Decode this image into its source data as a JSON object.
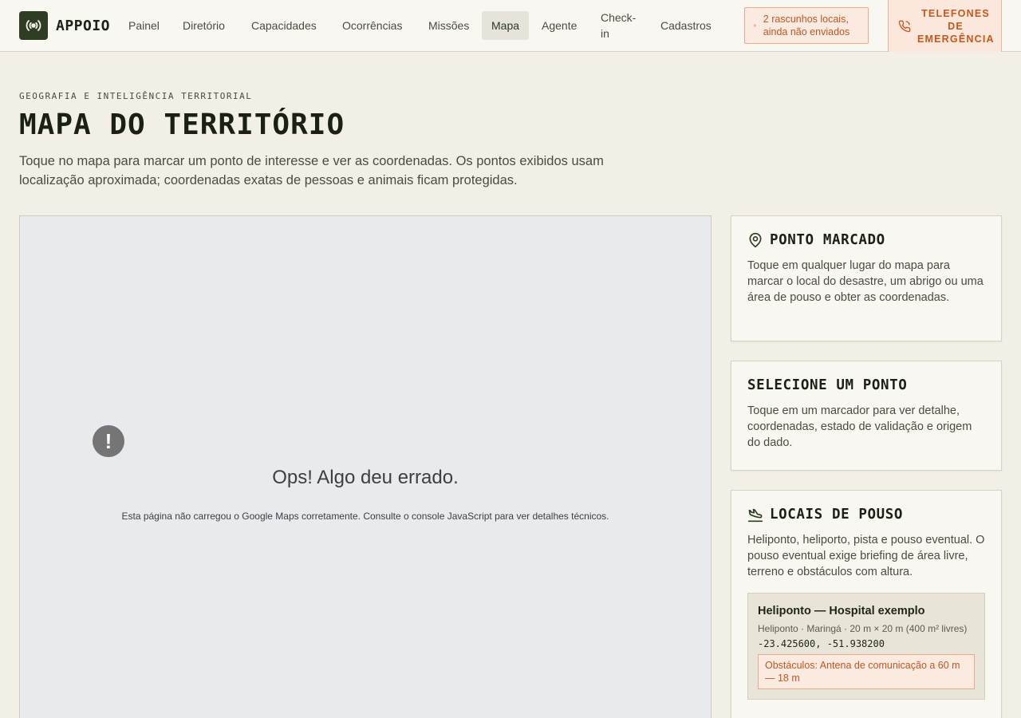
{
  "app": {
    "name": "APPOIO",
    "logo_icon": "radio-broadcast-icon"
  },
  "nav": {
    "items": [
      {
        "label": "Painel",
        "active": false
      },
      {
        "label": "Diretório",
        "active": false
      },
      {
        "label": "Capacidades",
        "active": false
      },
      {
        "label": "Ocorrências",
        "active": false
      },
      {
        "label": "Missões",
        "active": false
      },
      {
        "label": "Mapa",
        "active": true
      },
      {
        "label": "Agente",
        "active": false
      },
      {
        "label": "Check-in",
        "active": false
      },
      {
        "label": "Cadastros",
        "active": false
      }
    ],
    "drafts_badge": "2 rascunhos locais, ainda não enviados",
    "emergency_button": "TELEFONES DE EMERGÊNCIA"
  },
  "header": {
    "eyebrow": "GEOGRAFIA E INTELIGÊNCIA TERRITORIAL",
    "title": "MAPA DO TERRITÓRIO",
    "description": "Toque no mapa para marcar um ponto de interesse e ver as coordenadas. Os pontos exibidos usam localização aproximada; coordenadas exatas de pessoas e animais ficam protegidas."
  },
  "map": {
    "error_icon": "!",
    "error_title": "Ops! Algo deu errado.",
    "error_detail": "Esta página não carregou o Google Maps corretamente. Consulte o console JavaScript para ver detalhes técnicos."
  },
  "cards": {
    "marked_point": {
      "icon": "map-pin-icon",
      "title": "PONTO MARCADO",
      "body": "Toque em qualquer lugar do mapa para marcar o local do desastre, um abrigo ou uma área de pouso e obter as coordenadas."
    },
    "select_point": {
      "title": "SELECIONE UM PONTO",
      "body": "Toque em um marcador para ver detalhe, coordenadas, estado de validação e origem do dado."
    },
    "landing_sites": {
      "icon": "plane-landing-icon",
      "title": "LOCAIS DE POUSO",
      "body": "Heliponto, heliporto, pista e pouso eventual. O pouso eventual exige briefing de área livre, terreno e obstáculos com altura.",
      "items": [
        {
          "name": "Heliponto — Hospital exemplo",
          "meta": "Heliponto · Maringá · 20 m × 20 m (400 m² livres)",
          "coords": "-23.425600, -51.938200",
          "obstacles": "Obstáculos: Antena de comunicação a 60 m — 18 m"
        }
      ]
    }
  },
  "colors": {
    "background": "#f2efe7",
    "brand": "#2f3d22",
    "alert": "#c05623",
    "map_bg": "#e8eaed"
  }
}
